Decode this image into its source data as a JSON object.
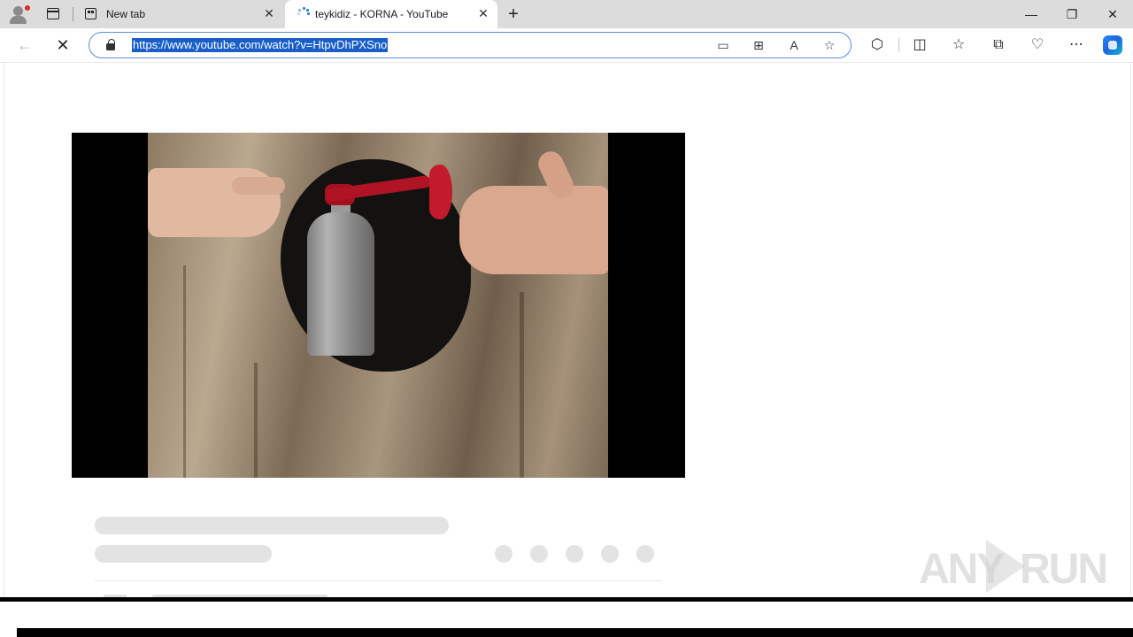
{
  "browser": {
    "tabs": [
      {
        "title": "New tab",
        "close_label": "✕"
      },
      {
        "title": "teykidiz - KORNA - YouTube",
        "close_label": "✕"
      }
    ],
    "new_tab_label": "+",
    "window_controls": {
      "minimize": "—",
      "restore": "❐",
      "close": "✕"
    },
    "address_bar": {
      "url": "https://www.youtube.com/watch?v=HtpvDhPXSno"
    },
    "navigation": {
      "back": "←",
      "stop": "✕"
    },
    "omnibox_icons": [
      "device-icon",
      "apps-icon",
      "read-aloud-icon",
      "favorite-star-icon"
    ],
    "toolbar_icons": [
      "extensions-icon",
      "split-screen-icon",
      "favorites-icon",
      "collections-icon",
      "browser-essentials-icon",
      "more-icon",
      "copilot-icon"
    ]
  },
  "watermark": {
    "left": "ANY",
    "right": "RUN"
  },
  "colors": {
    "tab_strip": "#dcdcdc",
    "url_selection": "#1a5fc7",
    "omnibox_border": "#5a8fd6",
    "skeleton": "#e3e3e3",
    "horn_red": "#b01424"
  }
}
